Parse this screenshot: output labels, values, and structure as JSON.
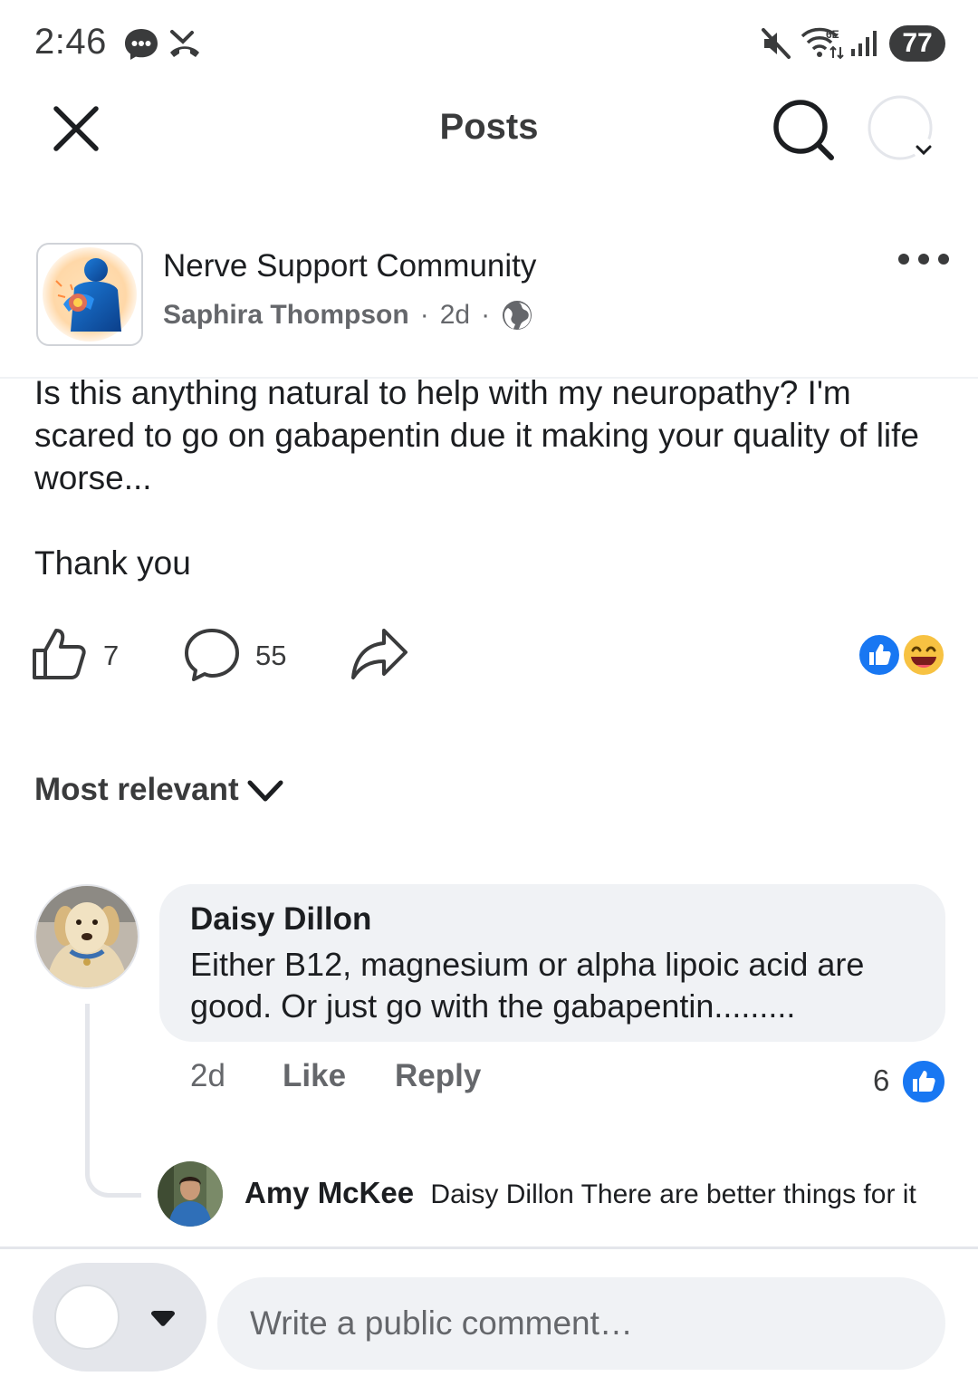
{
  "status_bar": {
    "time": "2:46",
    "battery": "77",
    "network_label": "6E",
    "icons": [
      "messenger-icon",
      "missed-call-icon",
      "mute-icon",
      "wifi-icon",
      "signal-icon",
      "battery-icon"
    ]
  },
  "header": {
    "title": "Posts",
    "icons": [
      "close-icon",
      "search-icon",
      "profile-avatar-icon"
    ]
  },
  "post": {
    "group_name": "Nerve Support Community",
    "author": "Saphira Thompson",
    "time": "2d",
    "separator": "·",
    "privacy_icon": "globe-icon",
    "text": "Is this anything natural to help with my neuropathy? I'm scared to go on gabapentin due it making your quality of life worse...",
    "text_2": "Thank you",
    "like_count": "7",
    "comment_count": "55",
    "reactions": [
      "like",
      "haha"
    ]
  },
  "comments_section": {
    "sort_label": "Most relevant",
    "comments": [
      {
        "author": "Daisy Dillon",
        "text": "Either B12, magnesium or alpha lipoic acid are good. Or just go with the gabapentin.........",
        "time": "2d",
        "like_label": "Like",
        "reply_label": "Reply",
        "like_count": "6",
        "reply": {
          "author": "Amy McKee",
          "text": "Daisy Dillon There are better things for it"
        }
      }
    ]
  },
  "composer": {
    "placeholder": "Write a public comment…"
  },
  "colors": {
    "facebook_blue": "#1877f2",
    "bubble_bg": "#f0f2f5",
    "secondary_text": "#65676b",
    "haha_yellow": "#f7c242"
  }
}
